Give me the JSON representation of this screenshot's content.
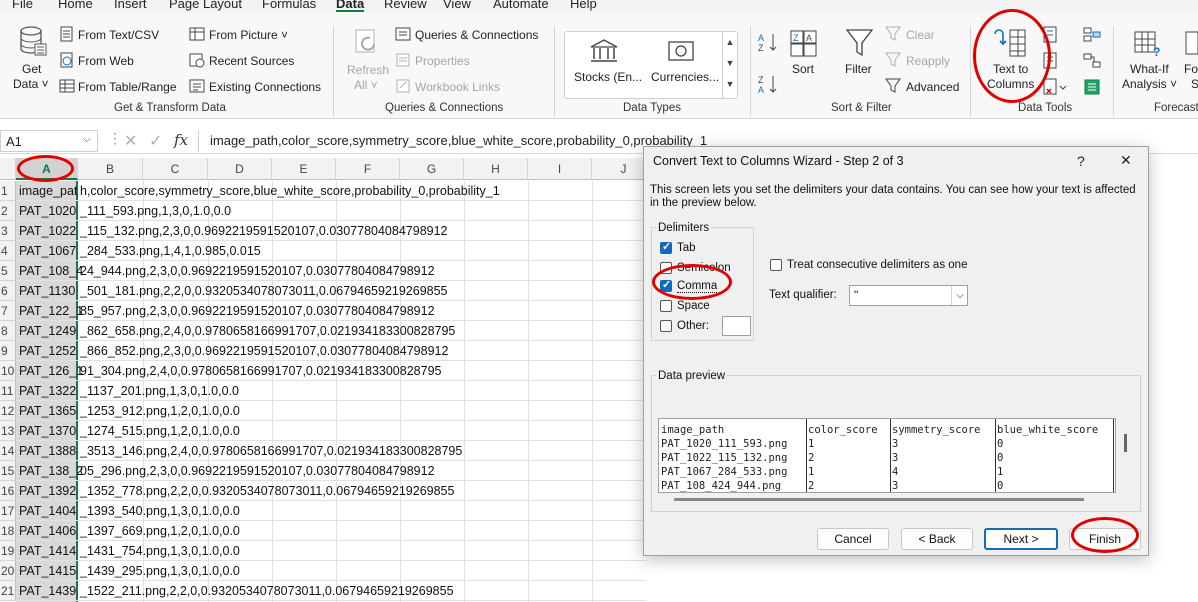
{
  "menu": [
    "File",
    "Home",
    "Insert",
    "Page Layout",
    "Formulas",
    "Data",
    "Review",
    "View",
    "Automate",
    "Help"
  ],
  "menu_active": "Data",
  "ribbon": {
    "get_data_line1": "Get",
    "get_data_line2": "Data ˅",
    "from_text_csv": "From Text/CSV",
    "from_web": "From Web",
    "from_table_range": "From Table/Range",
    "from_picture": "From Picture ˅",
    "recent_sources": "Recent Sources",
    "existing_connections": "Existing Connections",
    "group_get_transform": "Get & Transform Data",
    "refresh_all_line1": "Refresh",
    "refresh_all_line2": "All ˅",
    "queries_connections": "Queries & Connections",
    "properties": "Properties",
    "workbook_links": "Workbook Links",
    "group_queries": "Queries & Connections",
    "stocks": "Stocks (En...",
    "currencies": "Currencies...",
    "group_data_types": "Data Types",
    "sort": "Sort",
    "filter": "Filter",
    "clear": "Clear",
    "reapply": "Reapply",
    "advanced": "Advanced",
    "group_sort_filter": "Sort & Filter",
    "text_to_columns_line1": "Text to",
    "text_to_columns_line2": "Columns",
    "group_data_tools": "Data Tools",
    "what_if_line1": "What-If",
    "what_if_line2": "Analysis ˅",
    "fo_line1": "Fo",
    "fo_line2": "S",
    "group_forecast": "Forecast"
  },
  "formula_bar": {
    "name_box": "A1",
    "fx": "fx",
    "content": "image_path,color_score,symmetry_score,blue_white_score,probability_0,probability_1"
  },
  "columns": [
    "A",
    "B",
    "C",
    "D",
    "E",
    "F",
    "G",
    "H",
    "I",
    "J"
  ],
  "rows": [
    {
      "n": "1",
      "a": "image_pat",
      "rest": "h,color_score,symmetry_score,blue_white_score,probability_0,probability_1"
    },
    {
      "n": "2",
      "a": "PAT_1020",
      "rest": "_111_593.png,1,3,0,1.0,0.0"
    },
    {
      "n": "3",
      "a": "PAT_1022",
      "rest": "_115_132.png,2,3,0,0.9692219591520107,0.03077804084798912"
    },
    {
      "n": "4",
      "a": "PAT_1067",
      "rest": "_284_533.png,1,4,1,0.985,0.015"
    },
    {
      "n": "5",
      "a": "PAT_108_4",
      "rest": "24_944.png,2,3,0,0.9692219591520107,0.03077804084798912"
    },
    {
      "n": "6",
      "a": "PAT_1130",
      "rest": "_501_181.png,2,2,0,0.9320534078073011,0.06794659219269855"
    },
    {
      "n": "7",
      "a": "PAT_122_1",
      "rest": "85_957.png,2,3,0,0.9692219591520107,0.03077804084798912"
    },
    {
      "n": "8",
      "a": "PAT_1249",
      "rest": "_862_658.png,2,4,0,0.9780658166991707,0.021934183300828795"
    },
    {
      "n": "9",
      "a": "PAT_1252",
      "rest": "_866_852.png,2,3,0,0.9692219591520107,0.03077804084798912"
    },
    {
      "n": "10",
      "a": "PAT_126_1",
      "rest": "91_304.png,2,4,0,0.9780658166991707,0.021934183300828795"
    },
    {
      "n": "11",
      "a": "PAT_1322",
      "rest": "_1137_201.png,1,3,0,1.0,0.0"
    },
    {
      "n": "12",
      "a": "PAT_1365",
      "rest": "_1253_912.png,1,2,0,1.0,0.0"
    },
    {
      "n": "13",
      "a": "PAT_1370",
      "rest": "_1274_515.png,1,2,0,1.0,0.0"
    },
    {
      "n": "14",
      "a": "PAT_1388",
      "rest": "_3513_146.png,2,4,0,0.9780658166991707,0.021934183300828795"
    },
    {
      "n": "15",
      "a": "PAT_138_2",
      "rest": "05_296.png,2,3,0,0.9692219591520107,0.03077804084798912"
    },
    {
      "n": "16",
      "a": "PAT_1392",
      "rest": "_1352_778.png,2,2,0,0.9320534078073011,0.06794659219269855"
    },
    {
      "n": "17",
      "a": "PAT_1404",
      "rest": "_1393_540.png,1,3,0,1.0,0.0"
    },
    {
      "n": "18",
      "a": "PAT_1406",
      "rest": "_1397_669.png,1,2,0,1.0,0.0"
    },
    {
      "n": "19",
      "a": "PAT_1414",
      "rest": "_1431_754.png,1,3,0,1.0,0.0"
    },
    {
      "n": "20",
      "a": "PAT_1415",
      "rest": "_1439_295.png,1,3,0,1.0,0.0"
    },
    {
      "n": "21",
      "a": "PAT_1439",
      "rest": "_1522_211.png,2,2,0,0.9320534078073011,0.06794659219269855"
    }
  ],
  "dialog": {
    "title": "Convert Text to Columns Wizard - Step 2 of 3",
    "help": "?",
    "close": "✕",
    "description_line1": "This screen lets you set the delimiters your data contains.  You can see how your text is affected",
    "description_line2": "in the preview below.",
    "delimiters_label": "Delimiters",
    "tab": "Tab",
    "semicolon": "Semicolon",
    "comma": "Comma",
    "space": "Space",
    "other": "Other:",
    "tab_checked": true,
    "semicolon_checked": false,
    "comma_checked": true,
    "space_checked": false,
    "other_checked": false,
    "treat_consecutive": "Treat consecutive delimiters as one",
    "text_qualifier_label": "Text qualifier:",
    "text_qualifier_value": "\"",
    "data_preview_label": "Data preview",
    "preview_headers": [
      "image_path",
      "color_score",
      "symmetry_score",
      "blue_white_score"
    ],
    "preview_rows": [
      [
        "PAT_1020_111_593.png",
        "1",
        "3",
        "0"
      ],
      [
        "PAT_1022_115_132.png",
        "2",
        "3",
        "0"
      ],
      [
        "PAT_1067_284_533.png",
        "1",
        "4",
        "1"
      ],
      [
        "PAT_108_424_944.png",
        "2",
        "3",
        "0"
      ]
    ],
    "cancel": "Cancel",
    "back": "< Back",
    "next": "Next >",
    "finish": "Finish"
  },
  "colors": {
    "excel_green": "#217346",
    "accent_blue": "#0f6cbd",
    "annotation_red": "#e00000"
  }
}
